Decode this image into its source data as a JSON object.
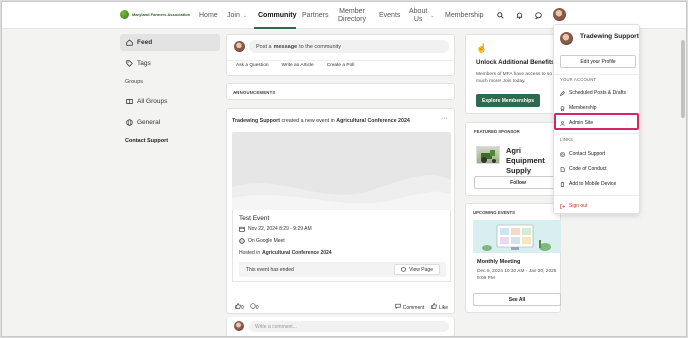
{
  "brand": {
    "name": "Maryland Farmers Association",
    "accent": "#2d6a4f"
  },
  "nav": {
    "items": [
      {
        "label": "Home"
      },
      {
        "label": "Join"
      },
      {
        "label": "Community"
      },
      {
        "label": "Partners"
      },
      {
        "label": "Member Directory"
      },
      {
        "label": "Events"
      },
      {
        "label": "About Us"
      },
      {
        "label": "Membership"
      }
    ],
    "icons": [
      "search-icon",
      "bell-icon",
      "chat-icon"
    ]
  },
  "sidebar": {
    "feed": "Feed",
    "tags": "Tags",
    "groups_head": "Groups",
    "all_groups": "All Groups",
    "general": "General",
    "contact": "Contact Support"
  },
  "composer": {
    "prefix": "Post a",
    "bold": "message",
    "suffix": "to the community",
    "actions": [
      "Ask a Question",
      "Write an Article",
      "Create a Poll"
    ]
  },
  "announcements": {
    "label": "ANNOUNCEMENTS"
  },
  "post": {
    "author": "Tradewing Support",
    "verb": "created a new event in",
    "group": "Agricultural Conference 2024",
    "event_title": "Test Event",
    "date": "Nov 22, 2024 8:29 - 9:29 AM",
    "location": "On Google Meet",
    "hosted_prefix": "Hosted in",
    "hosted_group": "Agricultural Conference 2024",
    "ended": "This event has ended",
    "view_page": "View Page",
    "likes": "0",
    "comments": "0",
    "comment_label": "Comment",
    "like_label": "Like",
    "comment_placeholder": "Write a comment..."
  },
  "benefits": {
    "title": "Unlock Additional Benefits",
    "text": "Members of MFA have access to so much more! Join today.",
    "button": "Explore Memberships"
  },
  "sponsor": {
    "head": "FEATURED SPONSOR",
    "name": "Agri Equipment\nSupply",
    "button": "Follow"
  },
  "upcoming": {
    "head": "UPCOMING EVENTS",
    "title": "Monthly Meeting",
    "date": "Dec 9, 2024 10:30 AM - Jan 30, 2025 9:09 PM",
    "button": "See All"
  },
  "dropdown": {
    "name": "Tradewing Support",
    "edit": "Edit your Profile",
    "your_account": "YOUR ACCOUNT",
    "scheduled": "Scheduled Posts & Drafts",
    "membership": "Membership",
    "admin": "Admin Site",
    "links": "LINKS",
    "contact": "Contact Support",
    "conduct": "Code of Conduct",
    "mobile": "Add to Mobile Device",
    "signout": "Sign out"
  }
}
